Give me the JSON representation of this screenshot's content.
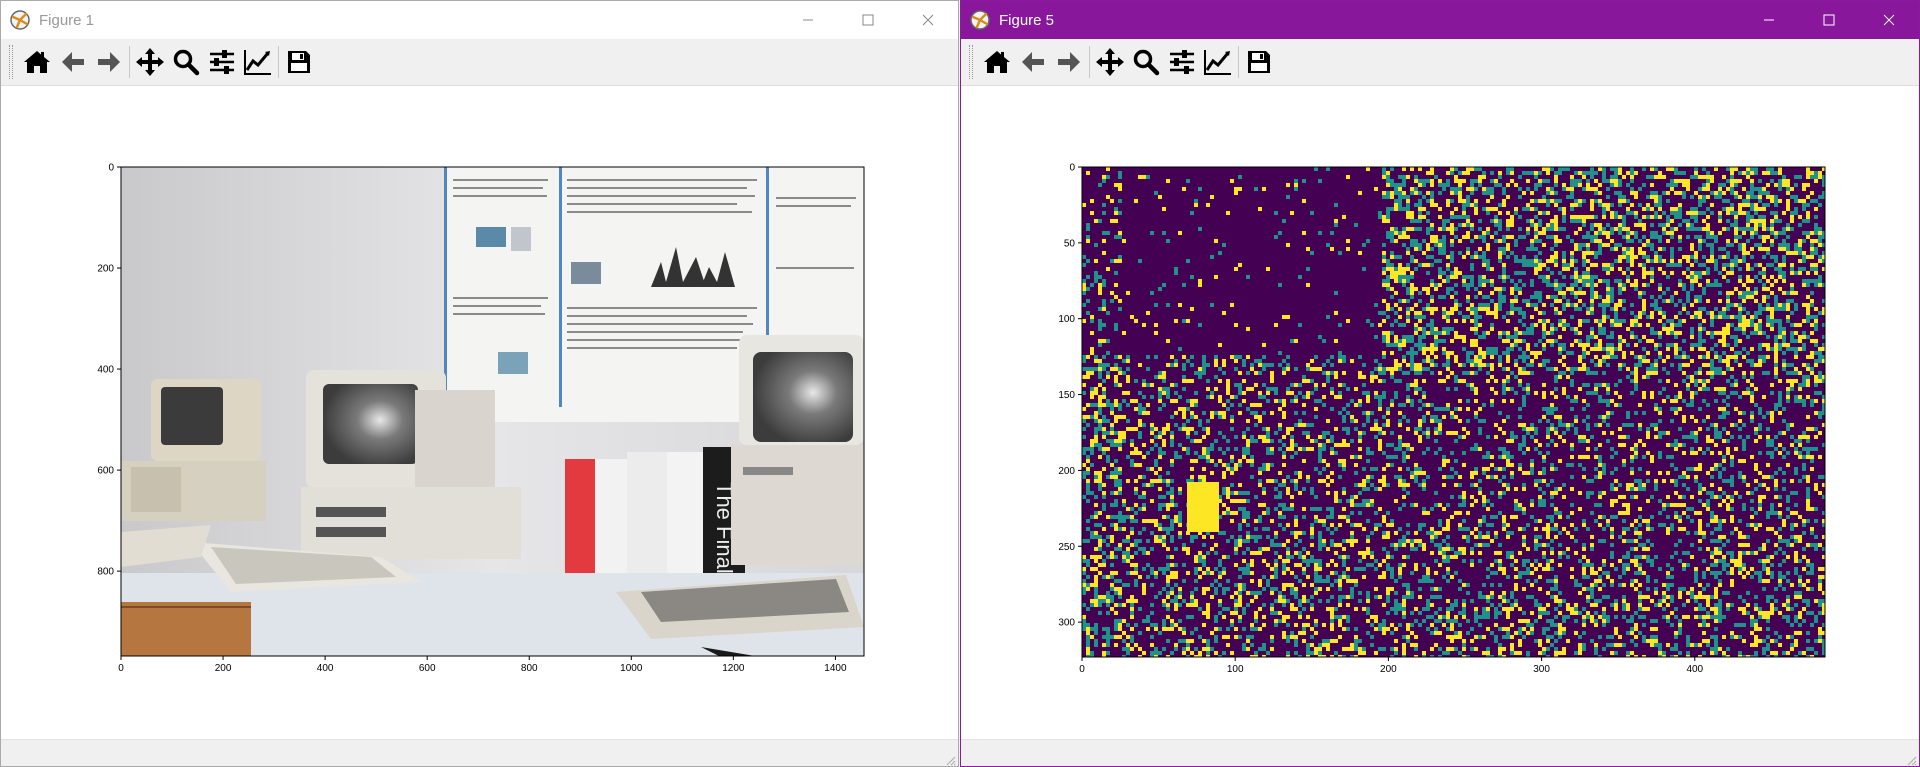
{
  "windows": [
    {
      "title": "Figure 1",
      "toolbar": [
        "home-icon",
        "back-arrow-icon",
        "forward-arrow-icon",
        "pan-icon",
        "zoom-icon",
        "configure-subplots-icon",
        "edit-axes-icon",
        "save-icon"
      ],
      "chart_data": {
        "type": "image",
        "image_description_shown": "color photograph of vintage computers on a desk",
        "x_ticks": [
          0,
          200,
          400,
          600,
          800,
          1000,
          1200,
          1400
        ],
        "y_ticks": [
          0,
          200,
          400,
          600,
          800
        ],
        "xlim": [
          0,
          1456
        ],
        "ylim": [
          968,
          0
        ]
      }
    },
    {
      "title": "Figure 5",
      "toolbar": [
        "home-icon",
        "back-arrow-icon",
        "forward-arrow-icon",
        "pan-icon",
        "zoom-icon",
        "configure-subplots-icon",
        "edit-axes-icon",
        "save-icon"
      ],
      "chart_data": {
        "type": "heatmap",
        "colormap": "viridis",
        "colors": {
          "low": "#440154",
          "mid": "#21918c",
          "high": "#fde725"
        },
        "x_ticks": [
          0,
          100,
          200,
          300,
          400
        ],
        "y_ticks": [
          0,
          50,
          100,
          150,
          200,
          250,
          300
        ],
        "xlim": [
          0,
          485
        ],
        "ylim": [
          323,
          0
        ]
      }
    }
  ]
}
